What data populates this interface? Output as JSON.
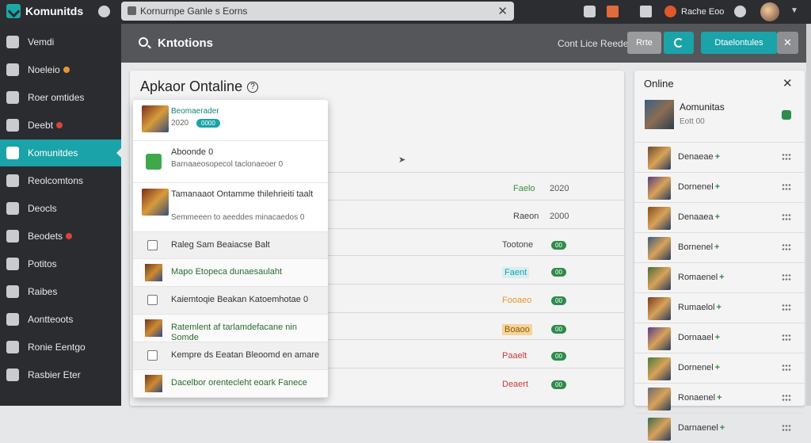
{
  "topbar": {
    "brand": "Komunitds",
    "url": "Kornurnpe Ganle s Eorns",
    "user": "Rache Eoo"
  },
  "sidebar": {
    "items": [
      {
        "label": "Vemdi",
        "badge": ""
      },
      {
        "label": "Noeleio",
        "badge": "orange"
      },
      {
        "label": "Roer omtides",
        "badge": ""
      },
      {
        "label": "Deebt",
        "badge": "red"
      },
      {
        "label": "Komunitdes",
        "badge": "",
        "active": true
      },
      {
        "label": "Reolcomtons",
        "badge": ""
      },
      {
        "label": "Deocls",
        "badge": ""
      },
      {
        "label": "Beodets",
        "badge": "red"
      },
      {
        "label": "Potitos",
        "badge": ""
      },
      {
        "label": "Raibes",
        "badge": ""
      },
      {
        "label": "Aontteoots",
        "badge": ""
      },
      {
        "label": "Ronie Eentgo",
        "badge": ""
      },
      {
        "label": "Rasbier Eter",
        "badge": ""
      }
    ]
  },
  "header": {
    "search_title": "Kntotions",
    "sub_label": "Cont Lice Reede",
    "small_btn": "Rrte",
    "primary_btn": "Dtaelontules",
    "colors": {
      "accent": "#1aa3a8",
      "header": "#545659"
    }
  },
  "main": {
    "title": "Apkaor Ontaline",
    "help": "?",
    "rows": [
      {
        "status": "Faelo",
        "value": "2020"
      },
      {
        "status": "Raeon",
        "value": "2000"
      },
      {
        "status": "Tootone",
        "pill": "00"
      },
      {
        "status": "Faent",
        "pill": "00"
      },
      {
        "status": "Fooaeo",
        "pill": "00"
      },
      {
        "status": "Boaoo",
        "pill": "00"
      },
      {
        "status": "Paaelt",
        "pill": "00"
      },
      {
        "status": "Deaert",
        "pill": "00"
      }
    ]
  },
  "dropdown": {
    "items": [
      {
        "title": "Beomaerader",
        "sub": "2020",
        "badge": "0000"
      },
      {
        "title": "Aboonde 0",
        "sub": "Barnaaeosopecol taclonaeoer 0"
      },
      {
        "title": "Tamanaaot Ontamme thilehrieiti taalt",
        "sub": "Semmeeen to aeeddes minacaedos 0"
      },
      {
        "title": "Raleg Sam Beaiacse Balt"
      },
      {
        "title": "Mapo Etopeca dunaesaulaht"
      },
      {
        "title": "Kaiemtoqie Beakan Katoemhotae 0"
      },
      {
        "title": "Ratemlent af tarlamdefacane nin Somde"
      },
      {
        "title": "Kempre ds Eeatan Bleoomd en amare"
      },
      {
        "title": "Dacelbor orentecleht eoark Fanece"
      }
    ]
  },
  "rpanel": {
    "title": "Online",
    "featured": {
      "name": "Aomunitas",
      "sub": "Eott 00"
    },
    "items": [
      "Denaeae",
      "Dornenel",
      "Denaaea",
      "Bornenel",
      "Romaenel",
      "Rumaelol",
      "Dornaael",
      "Dornenel",
      "Ronaenel",
      "Darnaenel"
    ]
  }
}
